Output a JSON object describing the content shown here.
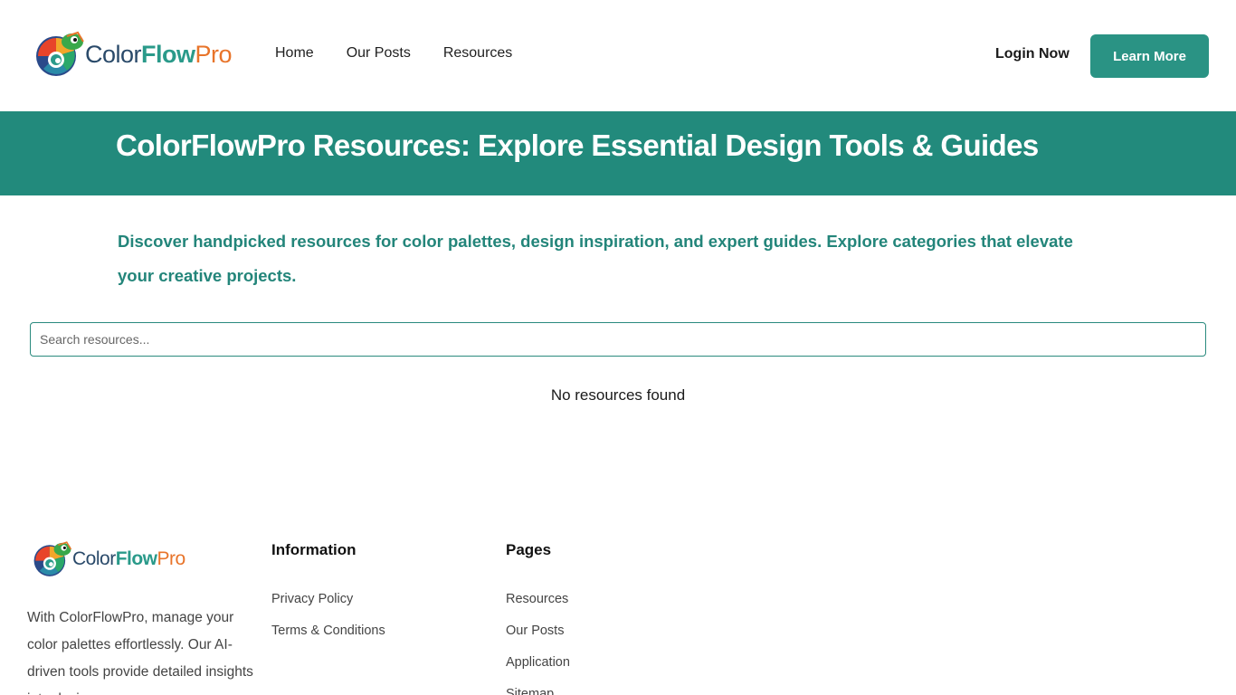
{
  "header": {
    "logo": {
      "part1": "Color",
      "part2": "Flow",
      "part3": "Pro"
    },
    "nav": [
      "Home",
      "Our Posts",
      "Resources"
    ],
    "login_label": "Login Now",
    "cta_label": "Learn More"
  },
  "banner": {
    "title": "ColorFlowPro Resources: Explore Essential Design Tools & Guides"
  },
  "main": {
    "intro": "Discover handpicked resources for color palettes, design inspiration, and expert guides. Explore categories that elevate your creative projects.",
    "search_placeholder": "Search resources...",
    "empty_message": "No resources found"
  },
  "footer": {
    "description": "With ColorFlowPro, manage your color palettes effortlessly. Our AI-driven tools provide detailed insights into design.",
    "information": {
      "heading": "Information",
      "links": [
        "Privacy Policy",
        "Terms & Conditions"
      ]
    },
    "pages": {
      "heading": "Pages",
      "links": [
        "Resources",
        "Our Posts",
        "Application",
        "Sitemap"
      ]
    }
  },
  "colors": {
    "brand_teal": "#228a7c",
    "button_teal": "#2a9384",
    "logo_orange": "#e8742a"
  },
  "icons": [
    "chameleon-logo-icon"
  ]
}
